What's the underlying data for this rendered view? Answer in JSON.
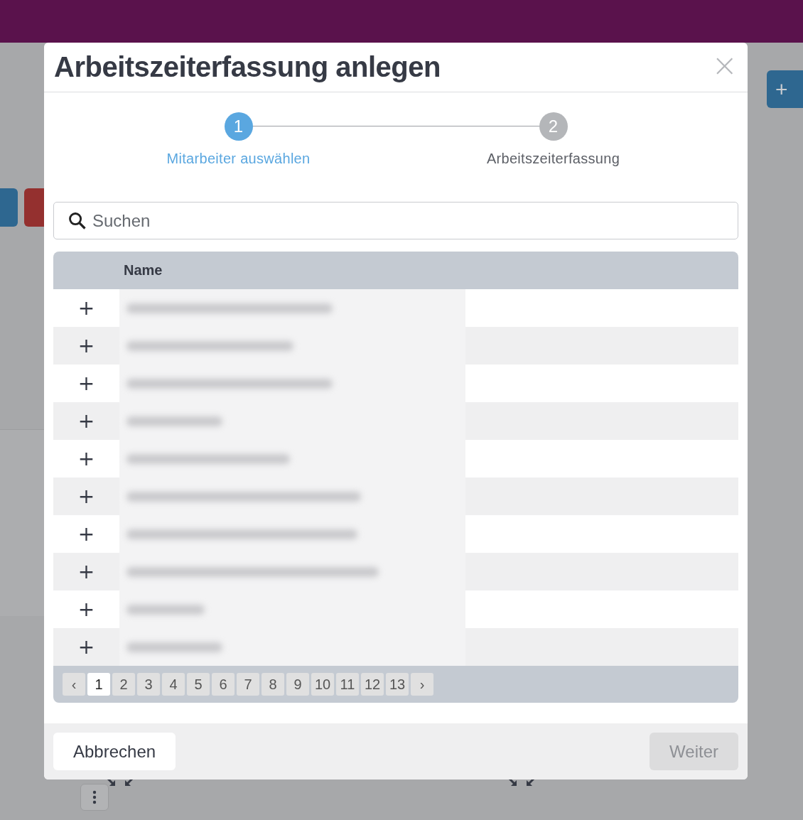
{
  "dialog": {
    "title": "Arbeitszeiterfassung anlegen",
    "close": "×"
  },
  "steps": [
    {
      "number": "1",
      "label": "Mitarbeiter auswählen",
      "selected": true
    },
    {
      "number": "2",
      "label": "Arbeitszeiterfassung",
      "selected": false
    }
  ],
  "search": {
    "placeholder": "Suchen"
  },
  "table": {
    "columns": [
      "Name"
    ],
    "rows": [
      {
        "action": "+"
      },
      {
        "action": "+"
      },
      {
        "action": "+"
      },
      {
        "action": "+"
      },
      {
        "action": "+"
      },
      {
        "action": "+"
      },
      {
        "action": "+"
      },
      {
        "action": "+"
      },
      {
        "action": "+"
      },
      {
        "action": "+"
      }
    ]
  },
  "pagination": {
    "prev": "‹",
    "next": "›",
    "pages": [
      {
        "label": "1",
        "selected": true
      },
      {
        "label": "2",
        "selected": false
      },
      {
        "label": "3",
        "selected": false
      },
      {
        "label": "4",
        "selected": false
      },
      {
        "label": "5",
        "selected": false
      },
      {
        "label": "6",
        "selected": false
      },
      {
        "label": "7",
        "selected": false
      },
      {
        "label": "8",
        "selected": false
      },
      {
        "label": "9",
        "selected": false
      },
      {
        "label": "10",
        "selected": false
      },
      {
        "label": "11",
        "selected": false
      },
      {
        "label": "12",
        "selected": false
      },
      {
        "label": "13",
        "selected": false
      }
    ]
  },
  "buttons": [
    {
      "label": "Abbrechen",
      "disabled": false
    },
    {
      "label": "Weiter",
      "disabled": true
    }
  ],
  "background": {
    "add_button": "+"
  }
}
